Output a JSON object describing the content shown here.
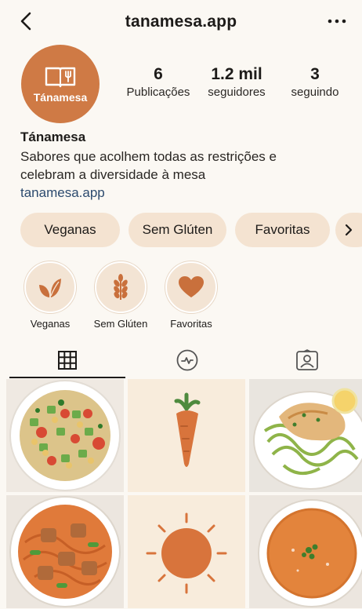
{
  "header": {
    "handle": "tanamesa.app"
  },
  "profile": {
    "avatar_text": "Tánamesa",
    "stats": [
      {
        "value": "6",
        "label": "Publicações"
      },
      {
        "value": "1.2 mil",
        "label": "seguidores"
      },
      {
        "value": "3",
        "label": "seguindo"
      }
    ],
    "name": "Tánamesa",
    "bio_line1": "Sabores que acolhem todas as restrições e",
    "bio_line2": "celebram a diversidade à mesa",
    "link": "tanamesa.app"
  },
  "chips": [
    "Veganas",
    "Sem Glúten",
    "Favoritas"
  ],
  "highlights": [
    {
      "label": "Veganas",
      "icon": "leaf-icon"
    },
    {
      "label": "Sem Glúten",
      "icon": "wheat-icon"
    },
    {
      "label": "Favoritas",
      "icon": "heart-icon"
    }
  ],
  "tabs": [
    {
      "name": "grid-icon"
    },
    {
      "name": "reels-icon"
    },
    {
      "name": "tagged-icon"
    }
  ],
  "posts": [
    "salad-image",
    "carrot-image",
    "chicken-zoodles-image",
    "pasta-image",
    "sun-image",
    "soup-image"
  ],
  "colors": {
    "accent": "#cf7a45",
    "chip_bg": "#f4e3d1",
    "link": "#2c4a6e",
    "background": "#fbf8f3"
  }
}
